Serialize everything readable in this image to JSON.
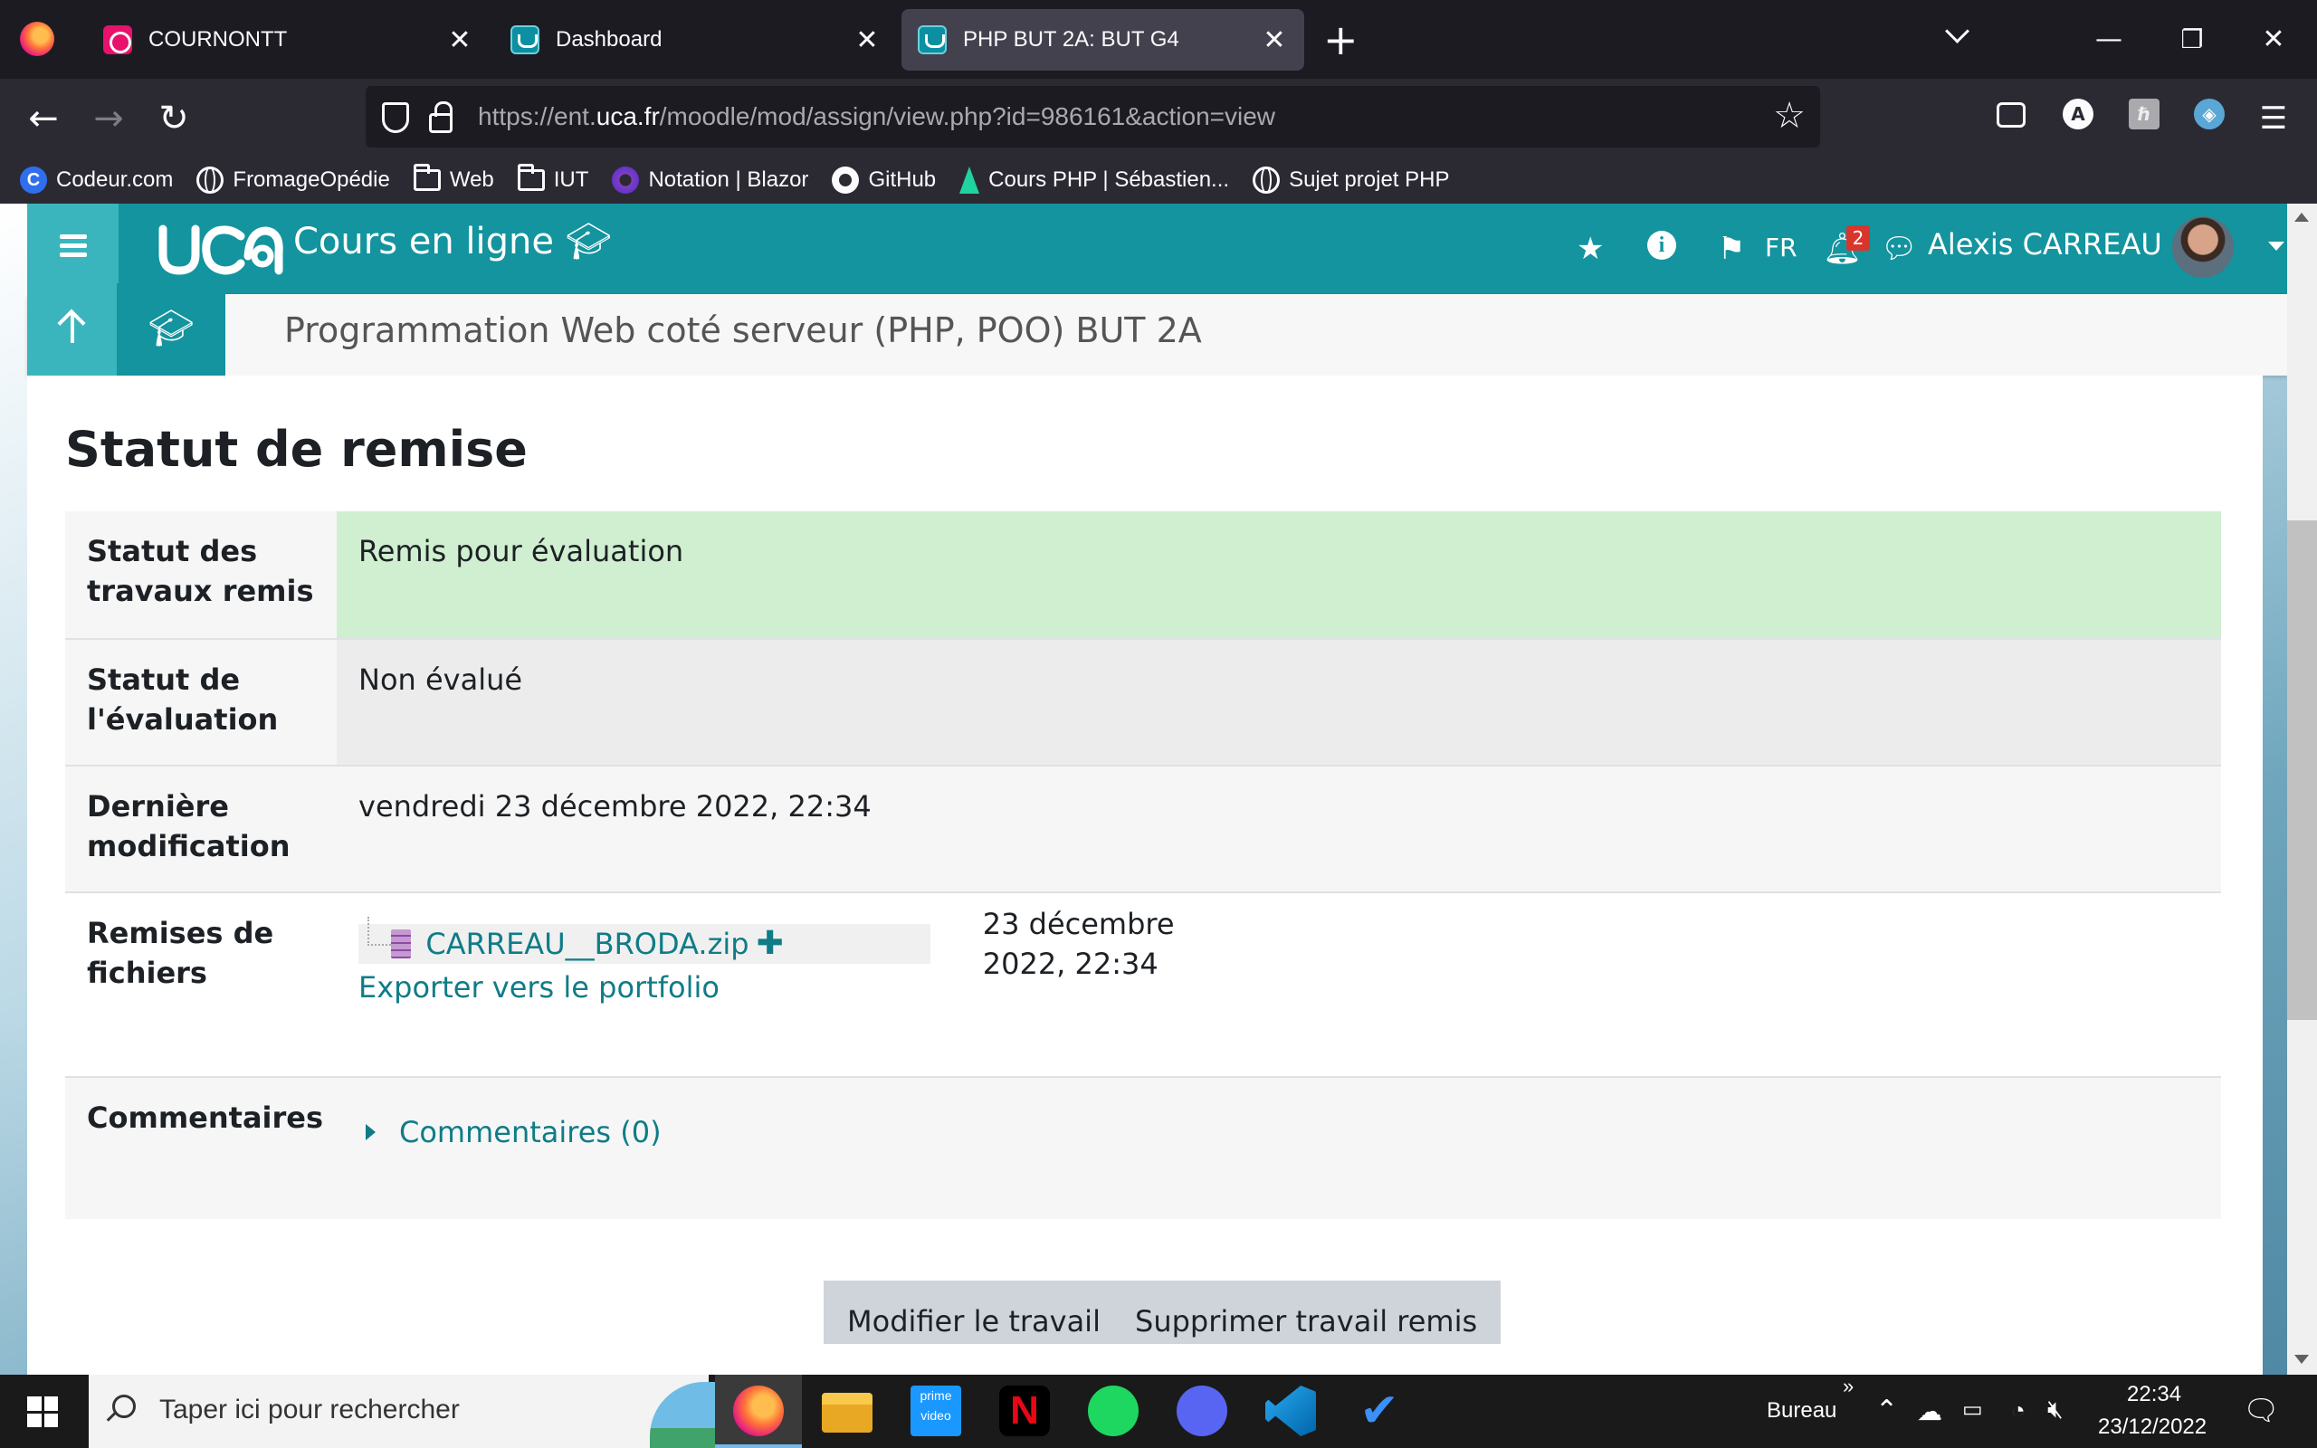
{
  "browser": {
    "tabs": [
      {
        "title": "COURNONTT",
        "active": false
      },
      {
        "title": "Dashboard",
        "active": false
      },
      {
        "title": "PHP BUT 2A: BUT G4",
        "active": true
      }
    ],
    "url_prefix": "https://ent.",
    "url_host": "uca.fr",
    "url_path": "/moodle/mod/assign/view.php?id=986161&action=view",
    "bookmarks": [
      {
        "label": "Codeur.com",
        "icon": "codeur-icon"
      },
      {
        "label": "FromageOpédie",
        "icon": "globe-icon"
      },
      {
        "label": "Web",
        "icon": "folder-icon"
      },
      {
        "label": "IUT",
        "icon": "folder-icon"
      },
      {
        "label": "Notation | Blazor",
        "icon": "blazor-icon"
      },
      {
        "label": "GitHub",
        "icon": "github-icon"
      },
      {
        "label": "Cours PHP | Sébastien...",
        "icon": "cours-icon"
      },
      {
        "label": "Sujet projet PHP",
        "icon": "globe-icon"
      }
    ]
  },
  "moodle": {
    "site_name": "Cours en ligne",
    "lang": "FR",
    "notification_count": "2",
    "user_name": "Alexis CARREAU",
    "course_title": "Programmation Web coté serveur (PHP, POO) BUT 2A",
    "section_heading": "Statut de remise",
    "rows": {
      "submission_status": {
        "label": "Statut des travaux remis",
        "value": "Remis pour évaluation"
      },
      "grading_status": {
        "label": "Statut de l'évaluation",
        "value": "Non évalué"
      },
      "last_modified": {
        "label": "Dernière modification",
        "value": "vendredi 23 décembre 2022, 22:34"
      },
      "file_submissions": {
        "label": "Remises de fichiers",
        "file_name": "CARREAU__BRODA.zip",
        "file_date": "23 décembre 2022, 22:34",
        "export": "Exporter vers le portfolio"
      },
      "comments": {
        "label": "Commentaires",
        "link": "Commentaires (0)"
      }
    },
    "buttons": {
      "edit": "Modifier le travail",
      "delete": "Supprimer travail remis"
    }
  },
  "taskbar": {
    "search_placeholder": "Taper ici pour rechercher",
    "desktop_label": "Bureau",
    "time": "22:34",
    "date": "23/12/2022"
  },
  "colors": {
    "moodle_primary": "#13949e",
    "moodle_light": "#3ab5bd",
    "link": "#0f7c87",
    "success_bg": "#cfefd0"
  }
}
